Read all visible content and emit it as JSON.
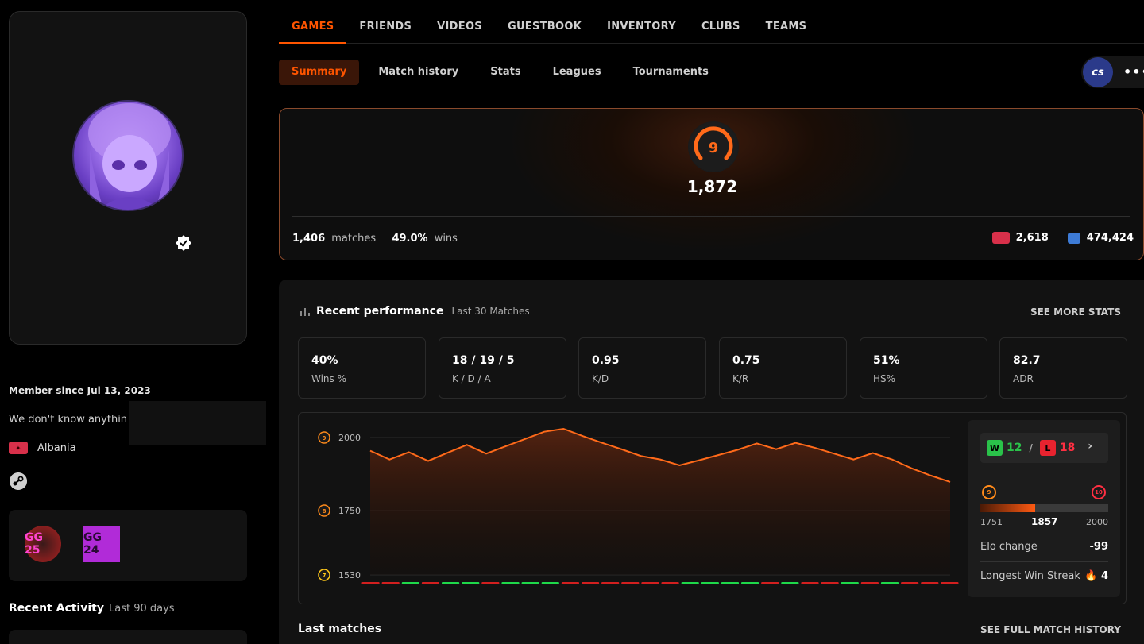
{
  "profile": {
    "member_since": "Member since Jul 13, 2023",
    "bio": "We don't know anythin",
    "country": "Albania",
    "country_flag_color": "#d8304a",
    "badges": [
      "GG 25",
      "GG 24"
    ],
    "recent_activity_title": "Recent Activity",
    "recent_activity_range": "Last 90 days"
  },
  "nav": {
    "main_tabs": [
      "GAMES",
      "FRIENDS",
      "VIDEOS",
      "GUESTBOOK",
      "INVENTORY",
      "CLUBS",
      "TEAMS"
    ],
    "active_main": "GAMES",
    "sub_tabs": [
      "Summary",
      "Match history",
      "Stats",
      "Leagues",
      "Tournaments"
    ],
    "active_sub": "Summary",
    "game_logo": "cs",
    "more": "•••"
  },
  "elo": {
    "level": "9",
    "value": "1,872",
    "matches": "1,406",
    "matches_label": "matches",
    "winrate": "49.0%",
    "wins_label": "wins",
    "country_rank": "2,618",
    "world_rank": "474,424",
    "accent": "#ff5500"
  },
  "performance": {
    "title": "Recent performance",
    "subtitle": "Last 30 Matches",
    "see_more": "SEE MORE STATS",
    "stats": [
      {
        "value": "40%",
        "label": "Wins %"
      },
      {
        "value": "18 / 19 / 5",
        "label": "K / D / A"
      },
      {
        "value": "0.95",
        "label": "K/D"
      },
      {
        "value": "0.75",
        "label": "K/R"
      },
      {
        "value": "51%",
        "label": "HS%"
      },
      {
        "value": "82.7",
        "label": "ADR"
      }
    ],
    "wins": "12",
    "losses": "18",
    "w_badge": "W",
    "l_badge": "L",
    "level_from": "9",
    "level_to": "10",
    "range_min": "1751",
    "range_current": "1857",
    "range_max": "2000",
    "progress_fraction": 0.43,
    "elo_change_label": "Elo change",
    "elo_change": "-99",
    "streak_label": "Longest Win Streak",
    "streak": "4",
    "last_matches": "Last matches",
    "full_history": "SEE FULL MATCH HISTORY"
  },
  "chart_data": {
    "type": "line",
    "y_ticks": [
      {
        "value": 2000,
        "label": "2000",
        "level": "9"
      },
      {
        "value": 1750,
        "label": "1750",
        "level": "8"
      },
      {
        "value": 1530,
        "label": "1530",
        "level": "7"
      }
    ],
    "ylim": [
      1530,
      2030
    ],
    "series": [
      {
        "values": [
          1955,
          1925,
          1950,
          1920,
          1948,
          1975,
          1945,
          1970,
          1995,
          2020,
          2030,
          2005,
          1982,
          1960,
          1937,
          1925,
          1905,
          1922,
          1940,
          1958,
          1980,
          1960,
          1982,
          1965,
          1945,
          1925,
          1947,
          1925,
          1895,
          1870,
          1848
        ]
      }
    ],
    "results": [
      "L",
      "L",
      "W",
      "L",
      "W",
      "W",
      "L",
      "W",
      "W",
      "W",
      "L",
      "L",
      "L",
      "L",
      "L",
      "L",
      "W",
      "W",
      "W",
      "W",
      "L",
      "W",
      "L",
      "L",
      "W",
      "L",
      "W",
      "L",
      "L",
      "L"
    ],
    "colors": {
      "line": "#ff6a1a",
      "win": "#1ed84a",
      "loss": "#d21f1f"
    },
    "grid": true
  }
}
